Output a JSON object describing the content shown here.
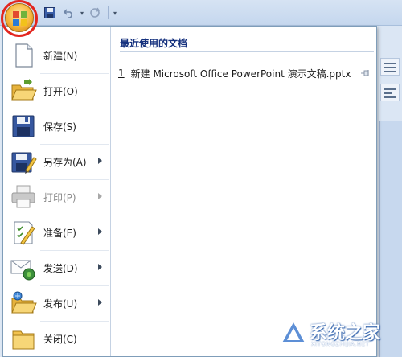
{
  "menu": {
    "items": [
      {
        "label": "新建(N)",
        "icon": "new-document-icon",
        "has_submenu": false,
        "enabled": true
      },
      {
        "label": "打开(O)",
        "icon": "open-folder-icon",
        "has_submenu": false,
        "enabled": true
      },
      {
        "label": "保存(S)",
        "icon": "save-disk-icon",
        "has_submenu": false,
        "enabled": true
      },
      {
        "label": "另存为(A)",
        "icon": "save-as-icon",
        "has_submenu": true,
        "enabled": true
      },
      {
        "label": "打印(P)",
        "icon": "printer-icon",
        "has_submenu": true,
        "enabled": false
      },
      {
        "label": "准备(E)",
        "icon": "prepare-icon",
        "has_submenu": true,
        "enabled": true
      },
      {
        "label": "发送(D)",
        "icon": "send-icon",
        "has_submenu": true,
        "enabled": true
      },
      {
        "label": "发布(U)",
        "icon": "publish-icon",
        "has_submenu": true,
        "enabled": true
      },
      {
        "label": "关闭(C)",
        "icon": "close-folder-icon",
        "has_submenu": false,
        "enabled": true
      }
    ]
  },
  "recent": {
    "title": "最近使用的文档",
    "documents": [
      {
        "number": "1",
        "name": "新建 Microsoft Office PowerPoint 演示文稿.pptx"
      }
    ]
  },
  "watermark": {
    "text": "系统之家",
    "subtext": "XITONGZHIJIA.NET"
  },
  "colors": {
    "accent_ring": "#e3261f",
    "heading": "#15317e",
    "office_orange": "#f6b63b"
  }
}
